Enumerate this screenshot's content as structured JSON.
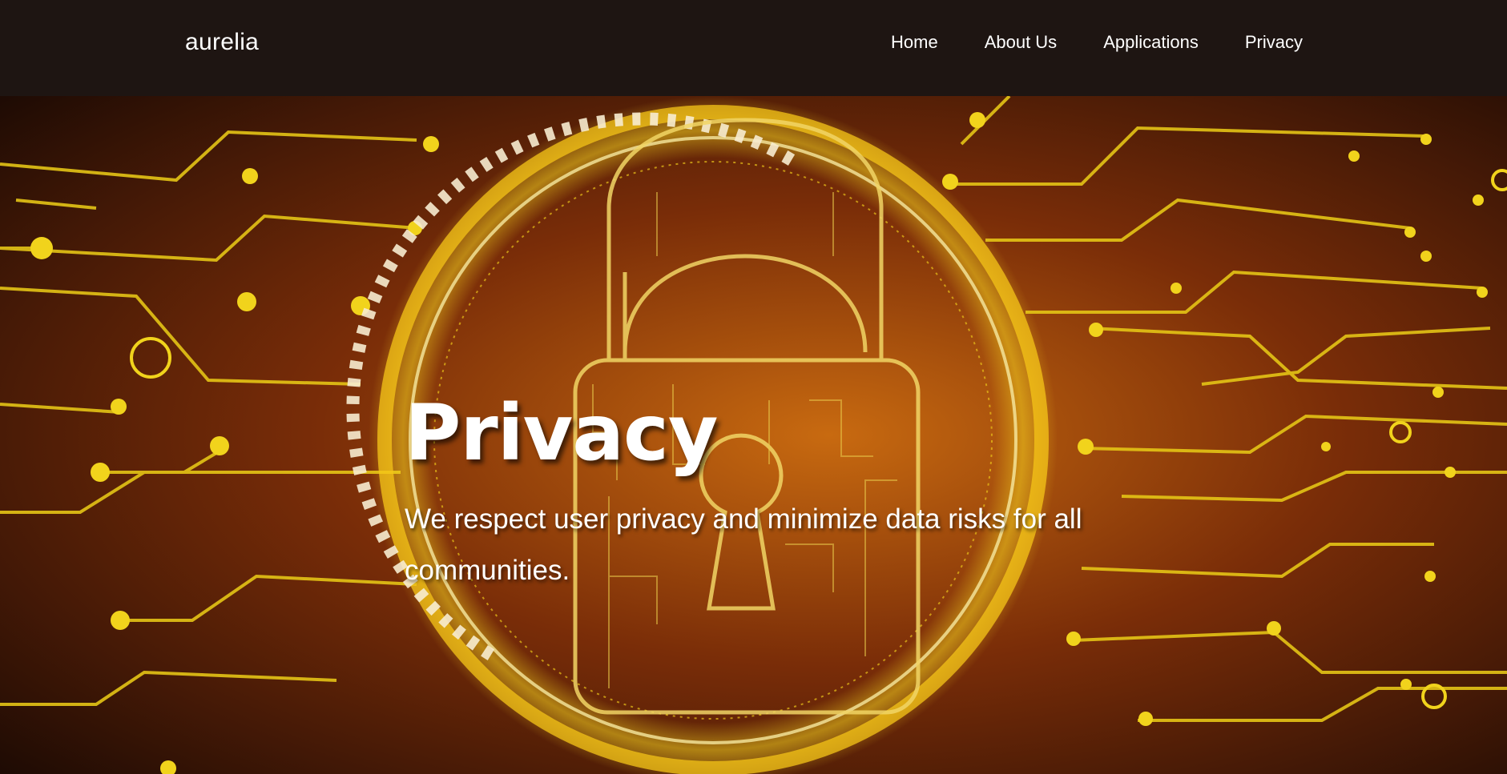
{
  "nav": {
    "brand": "aurelia",
    "links": [
      "Home",
      "About Us",
      "Applications",
      "Privacy"
    ]
  },
  "hero": {
    "title": "Privacy",
    "subtitle": "We respect user privacy and minimize data risks for all communities.",
    "background_image": "padlock-circuit-icon"
  },
  "colors": {
    "navbar_bg": "#1e1512",
    "hero_glow": "#f2d21a",
    "hero_dark": "#2a1205",
    "text": "#ffffff"
  }
}
